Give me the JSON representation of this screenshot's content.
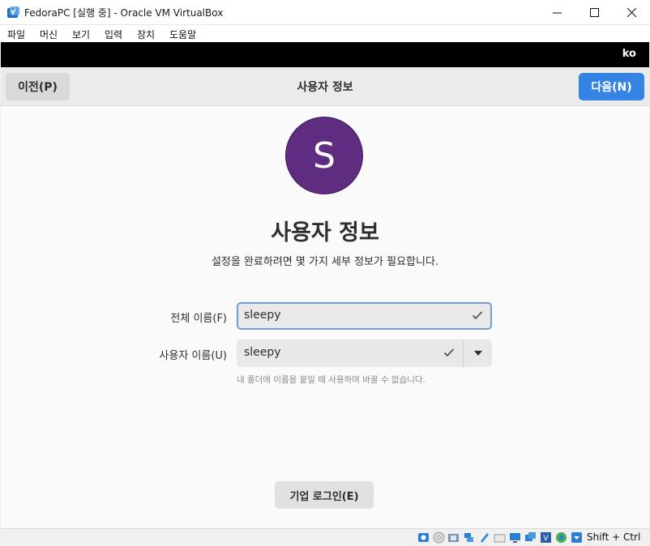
{
  "window": {
    "title": "FedoraPC [실행 중] - Oracle VM VirtualBox",
    "controls": [
      "minimize-icon",
      "maximize-icon",
      "close-icon"
    ]
  },
  "menubar": {
    "items": [
      "파일",
      "머신",
      "보기",
      "입력",
      "장치",
      "도움말"
    ]
  },
  "guest": {
    "topbar": {
      "keyboard_layout": "ko"
    },
    "header": {
      "prev_label": "이전(P)",
      "title": "사용자 정보",
      "next_label": "다음(N)"
    },
    "avatar": {
      "initial": "S",
      "color": "#5e2d82"
    },
    "page_title": "사용자 정보",
    "subtitle": "설정을 완료하려면 몇 가지 세부 정보가 필요합니다.",
    "form": {
      "full_name_label": "전체 이름(F)",
      "full_name_value": "sleepy",
      "username_label": "사용자 이름(U)",
      "username_value": "sleepy",
      "username_hint": "내 폴더에 이름을 붙일 때 사용하며 바꿀 수 없습니다."
    },
    "enterprise_login_label": "기업 로그인(E)"
  },
  "statusbar": {
    "icons": [
      "hard-disk-icon",
      "optical-drive-icon",
      "audio-icon",
      "network-icon",
      "usb-icon",
      "shared-folders-icon",
      "display-icon",
      "video-capture-icon",
      "virtualization-icon",
      "cpu-icon",
      "mouse-integration-icon",
      "host-key-icon"
    ],
    "host_key": "Shift + Ctrl"
  },
  "colors": {
    "accent": "#3584e4",
    "focus_border": "#6ea0d6",
    "guest_topbar": "#000000"
  }
}
